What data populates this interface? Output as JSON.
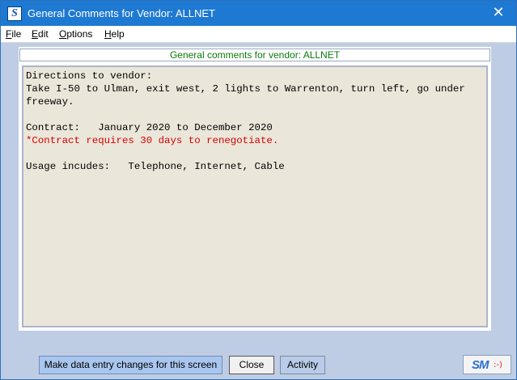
{
  "window": {
    "title": "General Comments for Vendor:  ALLNET",
    "app_icon_letter": "S",
    "close_glyph": "✕"
  },
  "menu": {
    "items": [
      {
        "label": "File",
        "mnemonic": "F",
        "rest": "ile"
      },
      {
        "label": "Edit",
        "mnemonic": "E",
        "rest": "dit"
      },
      {
        "label": "Options",
        "mnemonic": "O",
        "rest": "ptions"
      },
      {
        "label": "Help",
        "mnemonic": "H",
        "rest": "elp"
      }
    ]
  },
  "panel": {
    "header": "General comments for vendor: ALLNET",
    "lines": [
      {
        "text": "Directions to vendor:",
        "color": "#000000"
      },
      {
        "text": "Take I-50 to Ulman, exit west, 2 lights to Warrenton, turn left, go under",
        "color": "#000000"
      },
      {
        "text": "freeway.",
        "color": "#000000"
      },
      {
        "text": "",
        "color": "#000000"
      },
      {
        "text": "Contract:   January 2020 to December 2020",
        "color": "#000000"
      },
      {
        "text": "*Contract requires 30 days to renegotiate.",
        "color": "#d40000"
      },
      {
        "text": "",
        "color": "#000000"
      },
      {
        "text": "Usage incudes:   Telephone, Internet, Cable",
        "color": "#000000"
      }
    ]
  },
  "buttons": {
    "edit_label": "Make data entry changes for this screen",
    "close_label": "Close",
    "activity_label": "Activity",
    "logo_text": "SM",
    "logo_face": ":-)"
  },
  "colors": {
    "title_bar": "#1e79d2",
    "header_text": "#0c7a0c",
    "warning_text": "#d40000",
    "panel_bg": "#ebe6da"
  }
}
